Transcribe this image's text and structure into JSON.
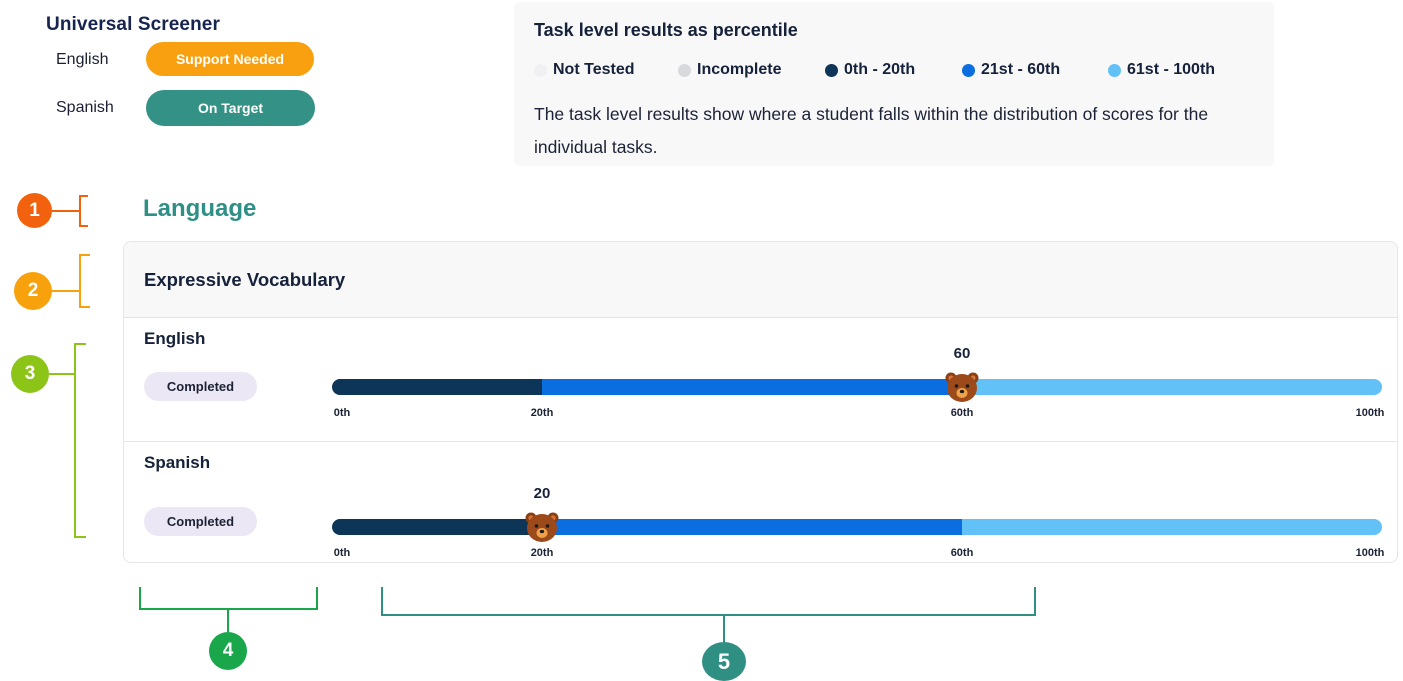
{
  "screener": {
    "title": "Universal Screener",
    "rows": [
      {
        "language": "English",
        "status": "Support Needed",
        "color": "#f8a010"
      },
      {
        "language": "Spanish",
        "status": "On Target",
        "color": "#349186"
      }
    ]
  },
  "legend": {
    "title": "Task level results as percentile",
    "items": [
      {
        "label": "Not Tested",
        "color": "#f0f0f2"
      },
      {
        "label": "Incomplete",
        "color": "#d8d9dd"
      },
      {
        "label": "0th - 20th",
        "color": "#0d3558"
      },
      {
        "label": "21st - 60th",
        "color": "#0b6ee0"
      },
      {
        "label": "61st - 100th",
        "color": "#62c2f8"
      }
    ],
    "description": "The task level results show where a student falls within the distribution of scores for the individual tasks."
  },
  "callouts": {
    "one": "1",
    "two": "2",
    "three": "3",
    "four": "4",
    "five": "5"
  },
  "section": {
    "title": "Language"
  },
  "task": {
    "title": "Expressive Vocabulary",
    "ticks": [
      "0th",
      "20th",
      "60th",
      "100th"
    ],
    "tick_values": [
      0,
      20,
      60,
      100
    ],
    "segments": [
      {
        "from": 0,
        "to": 20,
        "color": "#0d3558"
      },
      {
        "from": 20,
        "to": 60,
        "color": "#0b6ee0"
      },
      {
        "from": 60,
        "to": 100,
        "color": "#62c2f8"
      }
    ],
    "rows": [
      {
        "language": "English",
        "status": "Completed",
        "score": "60",
        "percentile": 60
      },
      {
        "language": "Spanish",
        "status": "Completed",
        "score": "20",
        "percentile": 20
      }
    ]
  }
}
